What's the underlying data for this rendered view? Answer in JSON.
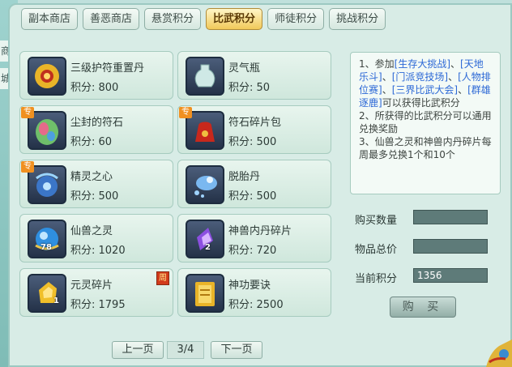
{
  "sidebar": {
    "chars": [
      "商",
      "城"
    ]
  },
  "tabs": [
    {
      "label": "副本商店",
      "active": false
    },
    {
      "label": "善恶商店",
      "active": false
    },
    {
      "label": "悬赏积分",
      "active": false
    },
    {
      "label": "比武积分",
      "active": true
    },
    {
      "label": "师徒积分",
      "active": false
    },
    {
      "label": "挑战积分",
      "active": false
    }
  ],
  "items": [
    {
      "name": "三级护符重置丹",
      "points": "积分: 800",
      "icon": "golden-amulet-icon"
    },
    {
      "name": "灵气瓶",
      "points": "积分: 50",
      "icon": "vase-icon"
    },
    {
      "name": "尘封的符石",
      "points": "积分: 60",
      "icon": "rune-stone-icon",
      "tag": "专"
    },
    {
      "name": "符石碎片包",
      "points": "积分: 500",
      "icon": "red-pouch-icon",
      "tag": "专"
    },
    {
      "name": "精灵之心",
      "points": "积分: 500",
      "icon": "spirit-heart-icon",
      "tag": "专"
    },
    {
      "name": "脱胎丹",
      "points": "积分: 500",
      "icon": "rebirth-pill-icon"
    },
    {
      "name": "仙兽之灵",
      "points": "积分: 1020",
      "icon": "blue-orb-icon",
      "count": "78"
    },
    {
      "name": "神兽内丹碎片",
      "points": "积分: 720",
      "icon": "purple-crystal-icon",
      "count": "2"
    },
    {
      "name": "元灵碎片",
      "points": "积分: 1795",
      "icon": "gold-fragment-icon",
      "count": "1",
      "week_tag": "周"
    },
    {
      "name": "神功要诀",
      "points": "积分: 2500",
      "icon": "golden-book-icon"
    }
  ],
  "info": {
    "p1_prefix": "1、参加",
    "links": [
      "[生存大挑战]",
      "[天地乐斗]",
      "[门派竞技场]",
      "[人物排位赛]",
      "[三界比武大会]",
      "[群雄逐鹿]"
    ],
    "sep": "、",
    "p1_suffix": "可以获得比武积分",
    "p2": "2、所获得的比武积分可以通用兑换奖励",
    "p3": "3、仙兽之灵和神兽内丹碎片每周最多兑换1个和10个"
  },
  "form": {
    "qty_label": "购买数量",
    "qty_value": "",
    "total_label": "物品总价",
    "total_value": "",
    "current_label": "当前积分",
    "current_value": "1356"
  },
  "buy_label": "购 买",
  "pager": {
    "prev": "上一页",
    "page": "3/4",
    "next": "下一页"
  }
}
